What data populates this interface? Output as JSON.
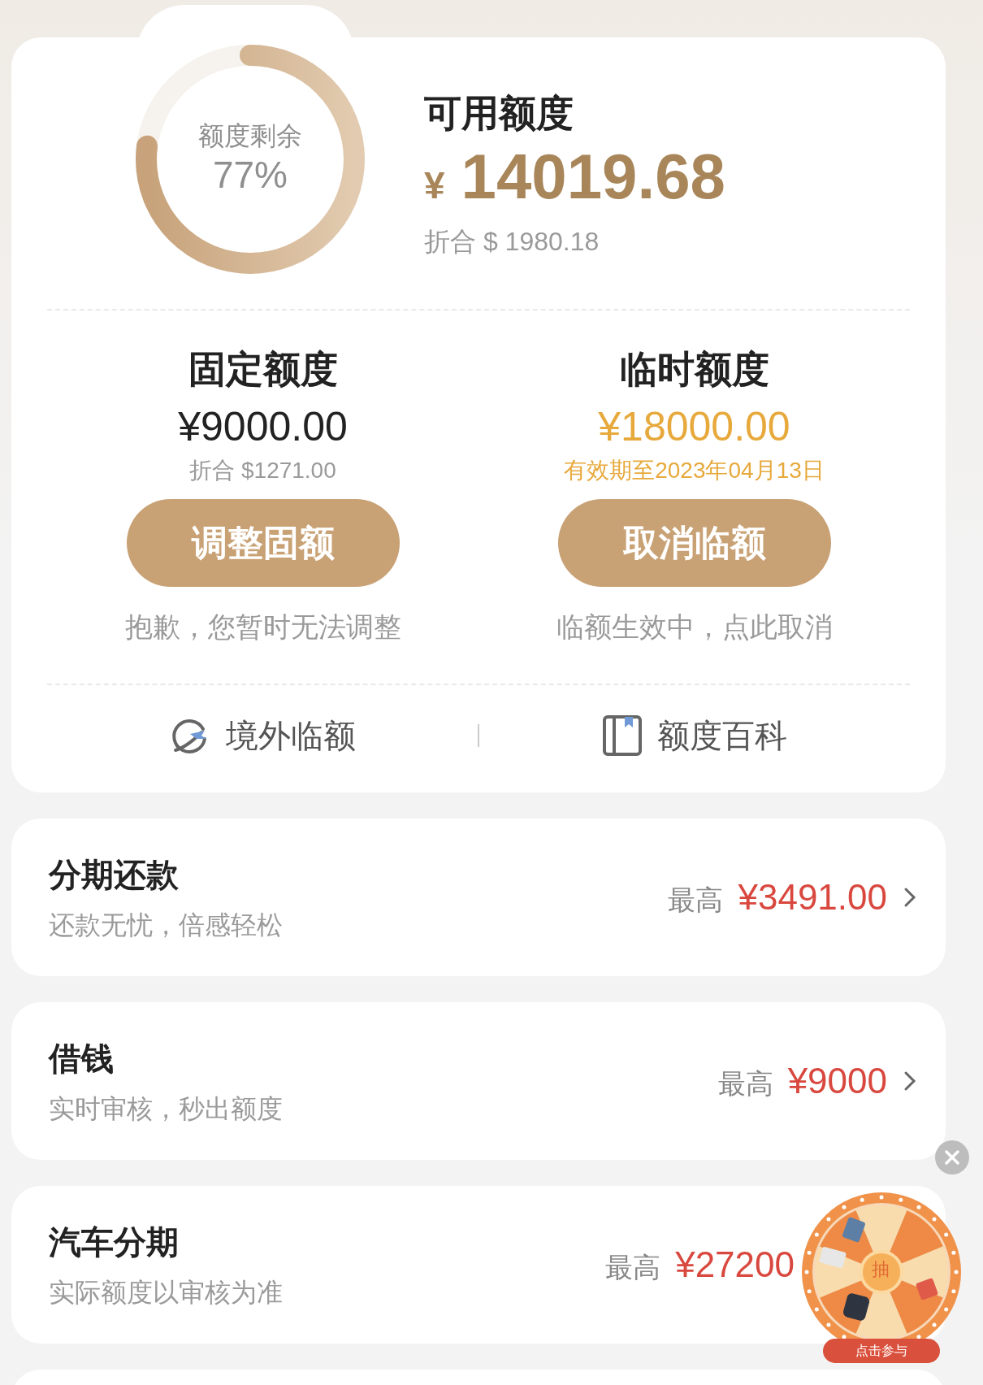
{
  "quota_card": {
    "gauge": {
      "label": "额度剩余",
      "percent": "77%"
    },
    "title": "可用额度",
    "currency": "¥",
    "amount": "14019.68",
    "converted": "折合 $ 1980.18",
    "columns": [
      {
        "title": "固定额度",
        "amount": "¥9000.00",
        "note": "折合 $1271.00",
        "highlight": false,
        "button": "调整固额",
        "hint": "抱歉，您暂时无法调整"
      },
      {
        "title": "临时额度",
        "amount": "¥18000.00",
        "note": "有效期至2023年04月13日",
        "highlight": true,
        "button": "取消临额",
        "hint": "临额生效中，点此取消"
      }
    ],
    "links": [
      {
        "label": "境外临额",
        "kind": "plane"
      },
      {
        "label": "额度百科",
        "kind": "book"
      }
    ]
  },
  "services": [
    {
      "title": "分期还款",
      "subtitle": "还款无忧，倍感轻松",
      "prefix": "最高",
      "amount": "¥3491.00",
      "chevron": true
    },
    {
      "title": "借钱",
      "subtitle": "实时审核，秒出额度",
      "prefix": "最高",
      "amount": "¥9000",
      "chevron": true
    },
    {
      "title": "汽车分期",
      "subtitle": "实际额度以审核为准",
      "prefix": "最高",
      "amount": "¥27200",
      "chevron": false
    }
  ],
  "lucky_wheel": {
    "center": "抽",
    "button": "点击参与"
  }
}
